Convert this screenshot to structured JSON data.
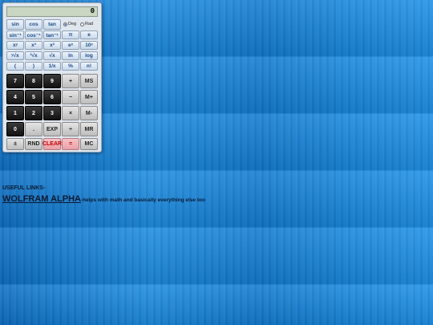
{
  "calculator": {
    "display_value": "0",
    "angle_modes": [
      {
        "label": "Deg",
        "selected": true
      },
      {
        "label": "Rad",
        "selected": false
      }
    ],
    "sci_rows": [
      [
        "sin",
        "cos",
        "tan"
      ],
      [
        "sin⁻¹",
        "cos⁻¹",
        "tan⁻¹",
        "π",
        "e"
      ],
      [
        "xʸ",
        "x³",
        "x²",
        "eˣ",
        "10ˣ"
      ],
      [
        "ʸ√x",
        "³√x",
        "√x",
        "ln",
        "log"
      ],
      [
        "(",
        ")",
        "1/x",
        "%",
        "n!"
      ]
    ],
    "keypad_rows": [
      [
        "7",
        "8",
        "9",
        "+",
        "MS"
      ],
      [
        "4",
        "5",
        "6",
        "−",
        "M+"
      ],
      [
        "1",
        "2",
        "3",
        "×",
        "M-"
      ],
      [
        "0",
        ".",
        "EXP",
        "÷",
        "MR"
      ],
      [
        "±",
        "RND",
        "CLEAR",
        "=",
        "MC"
      ]
    ]
  },
  "links": {
    "heading": "USEFUL LINKS-",
    "wolfram_label": "WOLFRAM ALPHA",
    "wolfram_desc": "-helps with math and basically everything else too"
  },
  "colors": {
    "background": "#1a8ae0",
    "keypad_dark": "#1a1a1a",
    "clear_text": "#c00000"
  }
}
